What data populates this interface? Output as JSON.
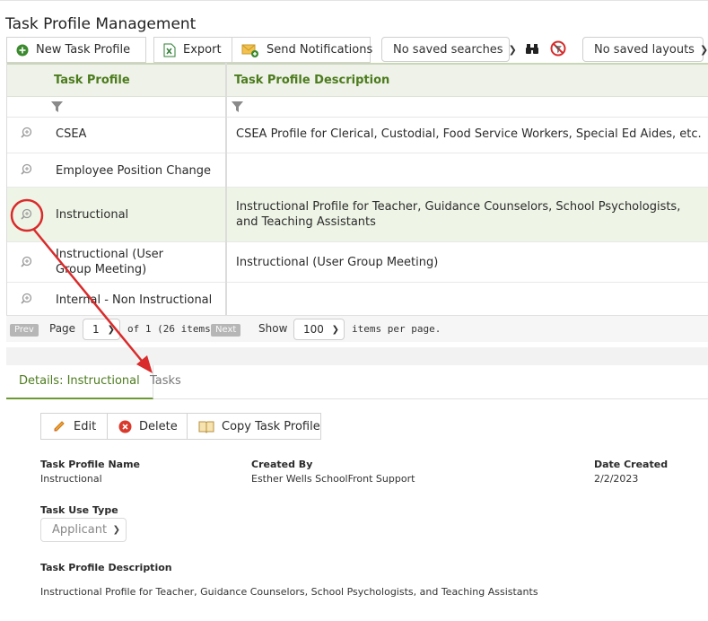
{
  "page": {
    "title": "Task Profile Management"
  },
  "toolbar": {
    "new_label": "New Task Profile",
    "export_label": "Export",
    "notify_label": "Send Notifications",
    "saved_searches": "No saved searches",
    "saved_layouts": "No saved layouts"
  },
  "grid": {
    "columns": [
      "Task Profile",
      "Task Profile Description"
    ],
    "rows": [
      {
        "name": "CSEA",
        "description": "CSEA Profile for Clerical, Custodial, Food Service Workers, Special Ed Aides, etc."
      },
      {
        "name": "Employee Position Change",
        "description": ""
      },
      {
        "name": "Instructional",
        "description": "Instructional Profile for Teacher, Guidance Counselors, School Psychologists, and Teaching Assistants"
      },
      {
        "name": "Instructional (User Group Meeting)",
        "description": "Instructional (User Group Meeting)"
      },
      {
        "name": "Internal - Non Instructional",
        "description": ""
      }
    ]
  },
  "pager": {
    "prev": "Prev",
    "page_label": "Page",
    "page_value": "1",
    "of_label": "of 1 (26 items)",
    "next": "Next",
    "show_label": "Show",
    "per_page_value": "100",
    "items_label": "items per page."
  },
  "details": {
    "tab_active": "Details: Instructional",
    "tab_tasks": "Tasks",
    "edit_label": "Edit",
    "delete_label": "Delete",
    "copy_label": "Copy Task Profile",
    "name_label": "Task Profile Name",
    "name_value": "Instructional",
    "created_by_label": "Created By",
    "created_by_value": "Esther Wells SchoolFront Support",
    "date_label": "Date Created",
    "date_value": "2/2/2023",
    "use_type_label": "Task Use Type",
    "use_type_value": "Applicant",
    "desc_label": "Task Profile Description",
    "desc_value": "Instructional Profile for Teacher, Guidance Counselors, School Psychologists, and Teaching Assistants"
  },
  "colors": {
    "accent": "#4c7b1d",
    "annotation": "#d92b2b"
  }
}
